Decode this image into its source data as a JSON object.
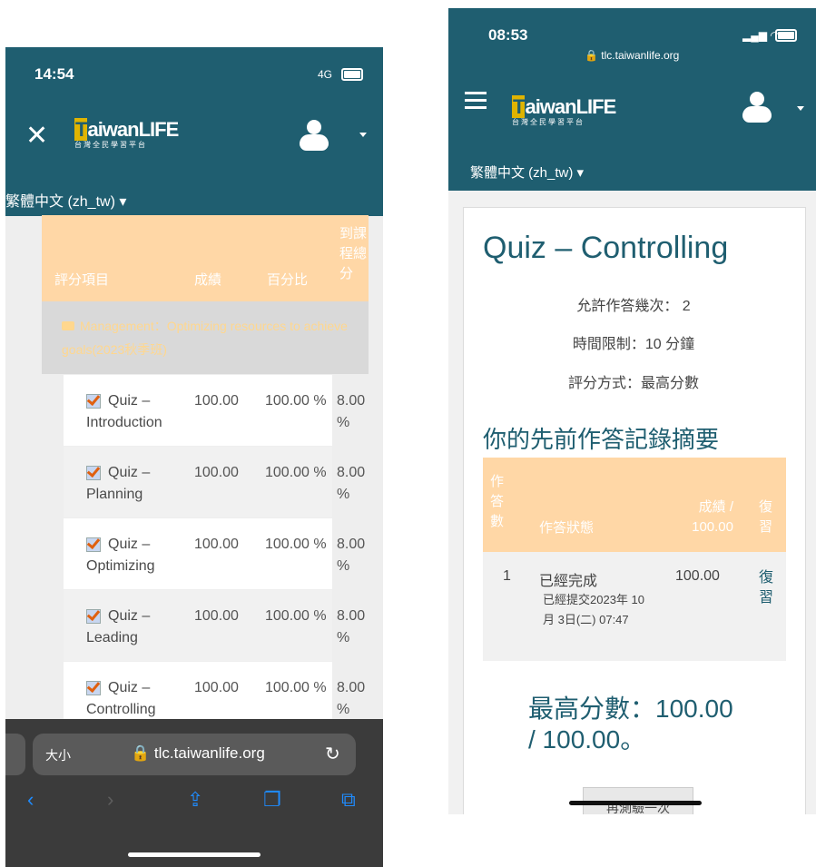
{
  "left": {
    "status_time": "14:54",
    "status_network": "4G",
    "logo_main": "TaiwanLIFE",
    "logo_sub": "台灣全民學習平台",
    "language": "繁體中文 (zh_tw)",
    "table_headers": [
      "評分項目",
      "成績",
      "百分比",
      "到課程總分"
    ],
    "category": "Management：Optimizing resources to achieve goals(2023秋季班)",
    "rows": [
      {
        "name": "Quiz – Introduction",
        "grade": "100.00",
        "percent": "100.00 %",
        "total": "8.00 %"
      },
      {
        "name": "Quiz – Planning",
        "grade": "100.00",
        "percent": "100.00 %",
        "total": "8.00 %"
      },
      {
        "name": "Quiz – Optimizing",
        "grade": "100.00",
        "percent": "100.00 %",
        "total": "8.00 %"
      },
      {
        "name": "Quiz – Leading",
        "grade": "100.00",
        "percent": "100.00 %",
        "total": "8.00 %"
      },
      {
        "name": "Quiz – Controlling",
        "grade": "100.00",
        "percent": "100.00 %",
        "total": "8.00 %"
      }
    ],
    "size_label": "大小",
    "url": "tlc.taiwanlife.org"
  },
  "right": {
    "status_time": "08:53",
    "url": "tlc.taiwanlife.org",
    "language": "繁體中文 (zh_tw)",
    "quiz_title": "Quiz – Controlling",
    "attempts_allowed": "允許作答幾次： 2",
    "time_limit": "時間限制：10 分鐘",
    "grading_method": "評分方式：最高分數",
    "summary_heading": "你的先前作答記錄摘要",
    "summary_headers": [
      "作答數",
      "作答狀態",
      "成績 / 100.00",
      "復習"
    ],
    "attempt": {
      "number": "1",
      "state": "已經完成",
      "submitted": "已經提交2023年 10月 3日(二) 07:47",
      "grade": "100.00",
      "review": "復習"
    },
    "highest_grade": "最高分數：100.00 / 100.00。",
    "reattempt_button": "再測驗一次"
  },
  "colors": {
    "header": "#1f5e70",
    "table_header": "#ffd7a6",
    "accent": "#1f5e70"
  }
}
